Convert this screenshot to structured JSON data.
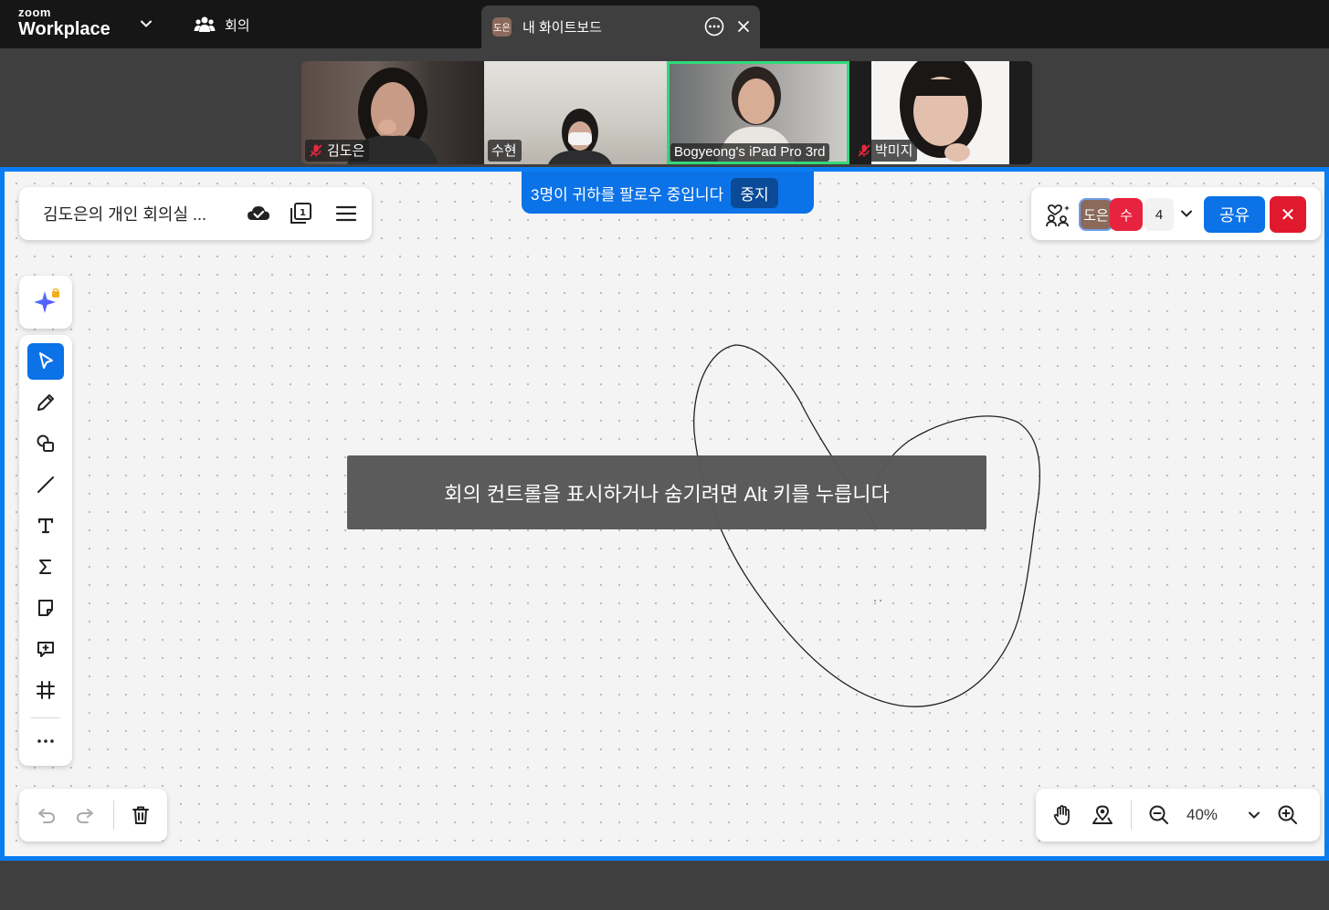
{
  "app": {
    "logo_small": "zoom",
    "logo_big": "Workplace"
  },
  "tabs": {
    "meeting": "회의",
    "whiteboard": {
      "avatar": "도은",
      "label": "내 화이트보드"
    }
  },
  "participants": [
    {
      "name": "김도은",
      "muted": true
    },
    {
      "name": "수현",
      "muted": false
    },
    {
      "name": "Bogyeong's iPad Pro 3rd",
      "muted": false,
      "active": true
    },
    {
      "name": "박미지",
      "muted": true
    }
  ],
  "whiteboard": {
    "title": "김도은의 개인 회의실 ...",
    "follow_banner": "3명이 귀하를 팔로우 중입니다",
    "stop_label": "중지",
    "avatars": [
      "도은",
      "수"
    ],
    "participant_count": "4",
    "share_label": "공유",
    "close_label": "✕",
    "zoom_level": "40%",
    "toast": "회의 컨트롤을 표시하거나 숨기려면 Alt 키를 누릅니다"
  },
  "tools": [
    "select-tool",
    "pen-tool",
    "shapes-tool",
    "line-tool",
    "text-tool",
    "formula-tool",
    "sticky-note-tool",
    "comment-tool",
    "frame-tool",
    "more-tool"
  ],
  "colors": {
    "accent": "#0b72e7",
    "frame": "#0b7df2",
    "close": "#e1192f",
    "active_speaker": "#30d97a"
  }
}
